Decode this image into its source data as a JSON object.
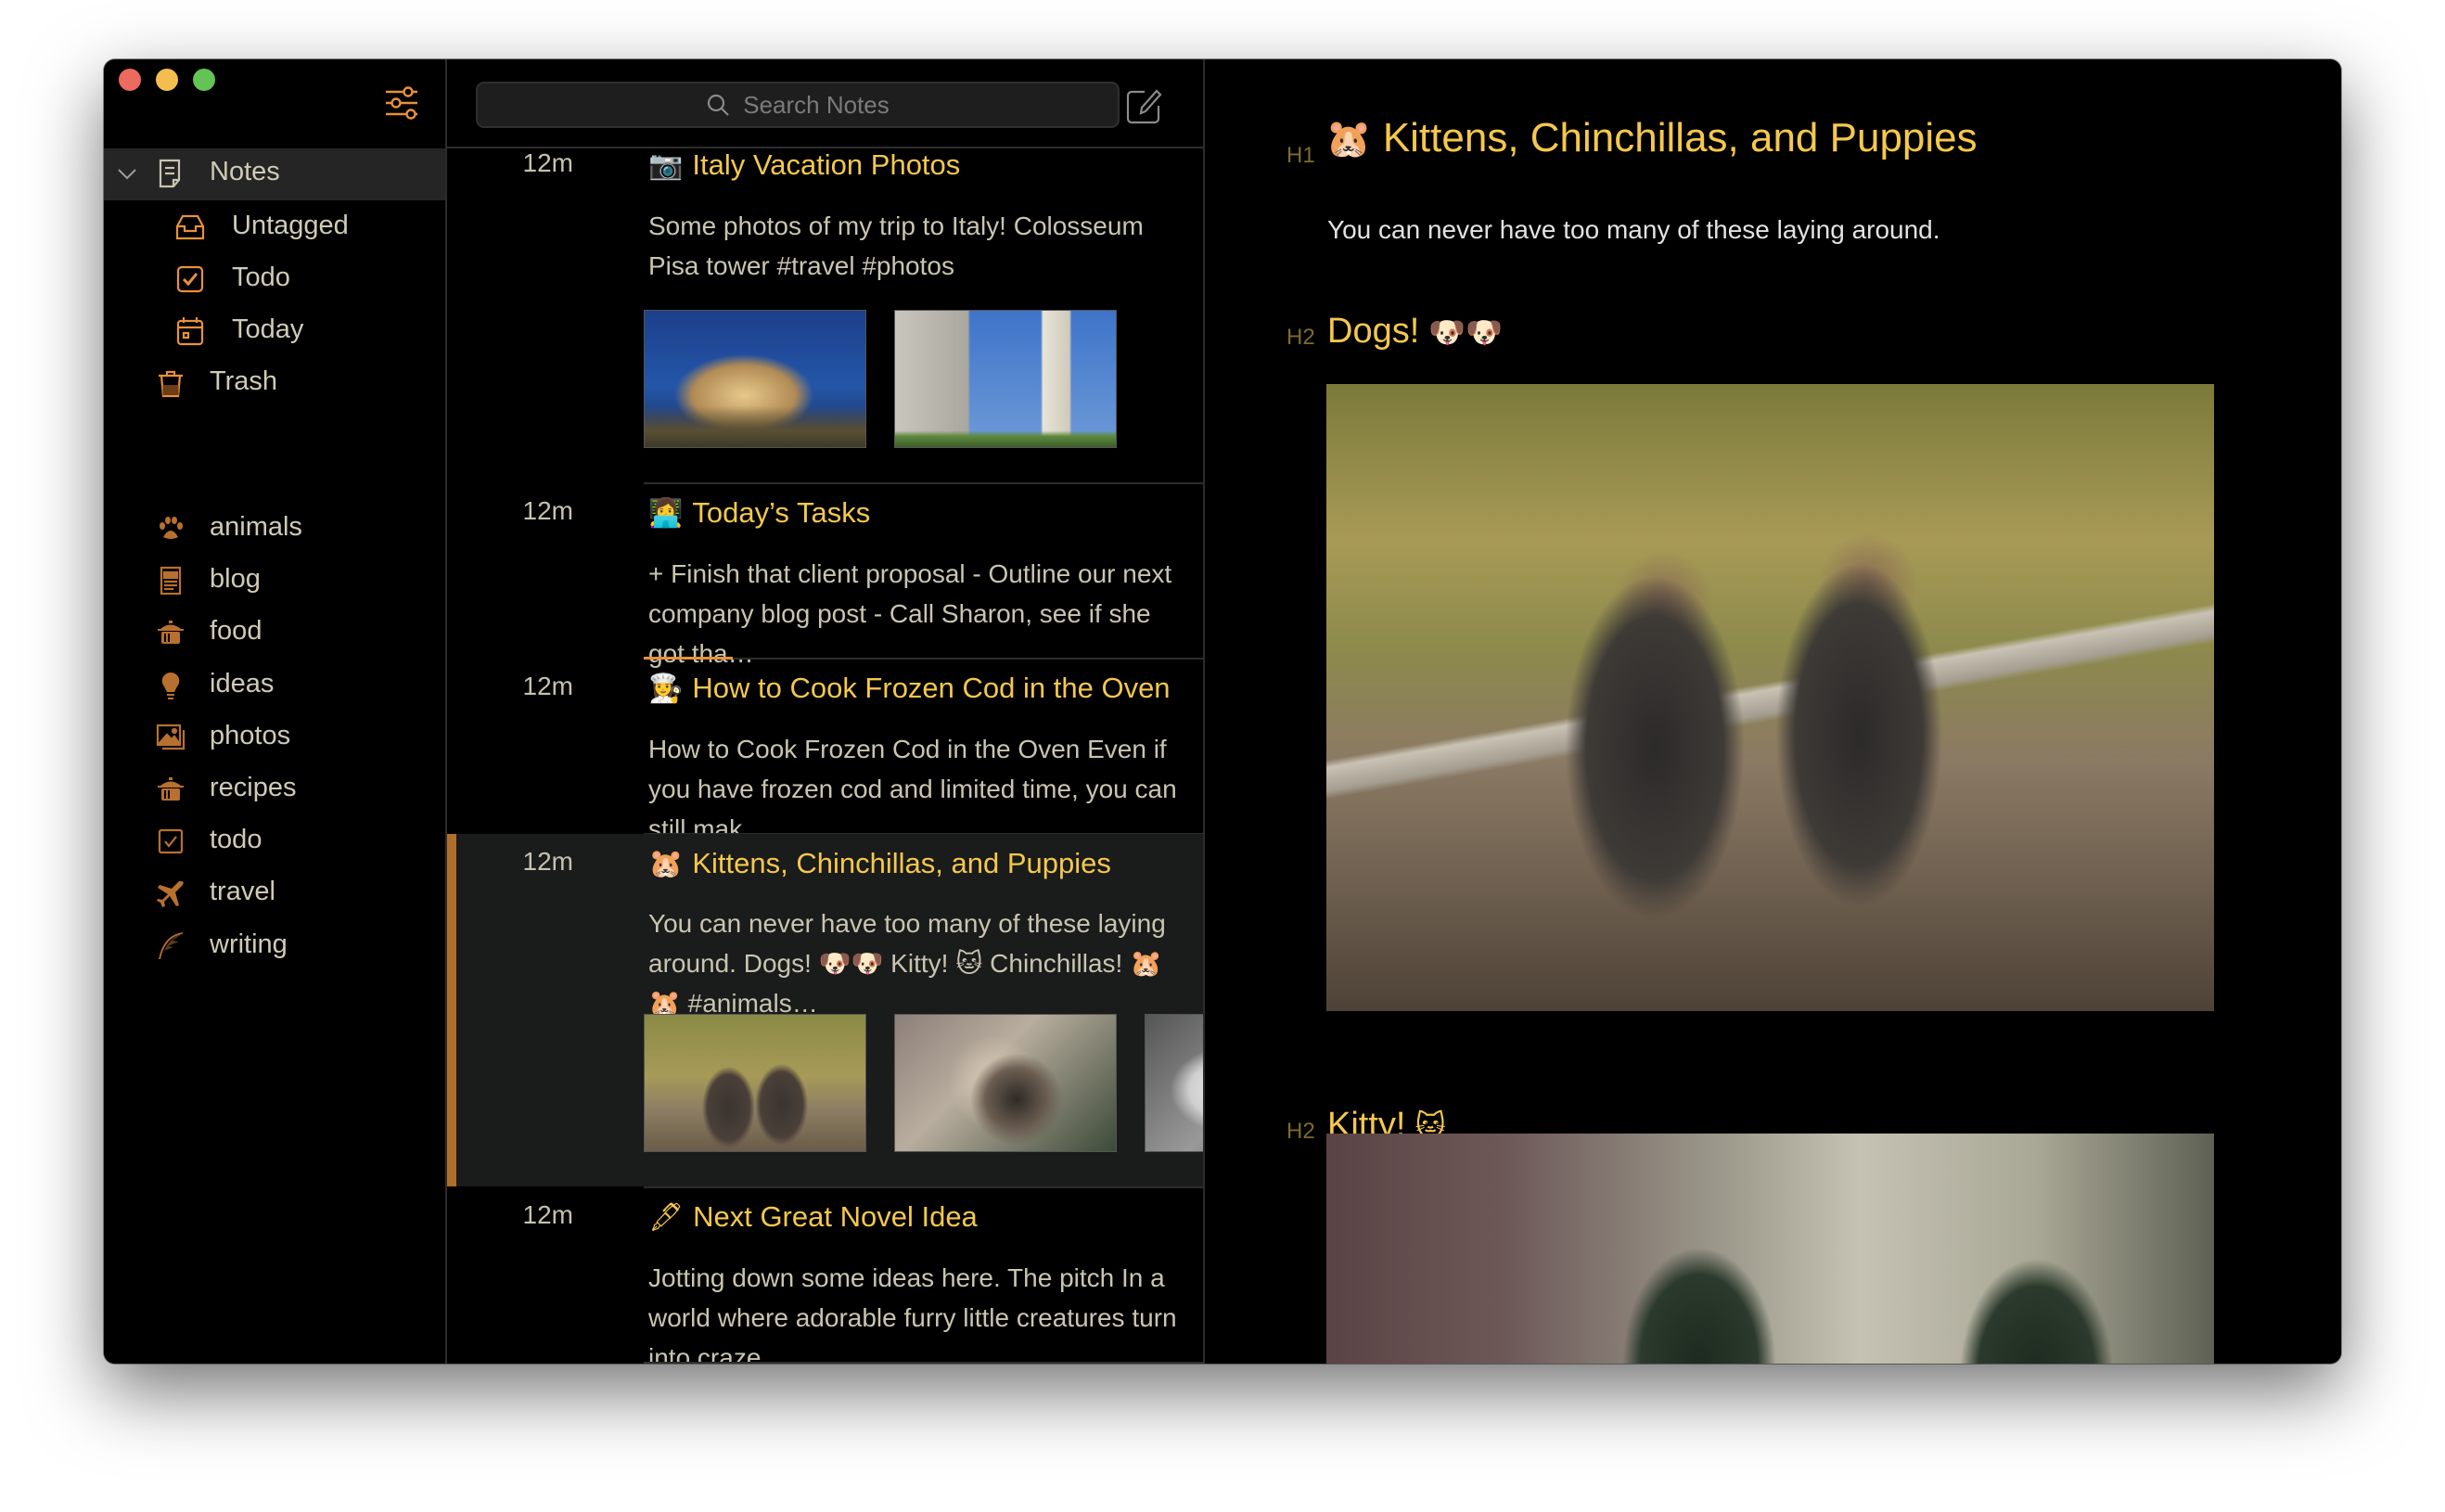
{
  "window": {
    "traffic_lights": [
      {
        "name": "close",
        "color": "#ec6a5e"
      },
      {
        "name": "minimize",
        "color": "#f4be4f"
      },
      {
        "name": "zoom",
        "color": "#61c454"
      }
    ]
  },
  "colors": {
    "accent": "#e8913a",
    "title": "#f5c84c",
    "selected_bar": "#b06f2c"
  },
  "sidebar": {
    "filter_icon": "sliders-icon",
    "notes": {
      "label": "Notes",
      "icon": "note-icon",
      "expanded": true
    },
    "sections": [
      {
        "label": "Untagged",
        "icon": "inbox-icon"
      },
      {
        "label": "Todo",
        "icon": "checkbox-icon"
      },
      {
        "label": "Today",
        "icon": "calendar-icon"
      }
    ],
    "trash": {
      "label": "Trash",
      "icon": "trash-icon"
    },
    "tags": [
      {
        "label": "animals",
        "icon": "paw-icon"
      },
      {
        "label": "blog",
        "icon": "newspaper-icon"
      },
      {
        "label": "food",
        "icon": "pot-icon"
      },
      {
        "label": "ideas",
        "icon": "lightbulb-icon"
      },
      {
        "label": "photos",
        "icon": "photos-icon"
      },
      {
        "label": "recipes",
        "icon": "pot-icon"
      },
      {
        "label": "todo",
        "icon": "checkbox-icon"
      },
      {
        "label": "travel",
        "icon": "airplane-icon"
      },
      {
        "label": "writing",
        "icon": "quill-icon"
      }
    ]
  },
  "note_list": {
    "search_placeholder": "Search Notes",
    "compose_icon": "compose-icon",
    "notes": [
      {
        "time": "12m",
        "emoji": "📷",
        "title": "Italy Vacation Photos",
        "snippet": "Some photos of my trip to Italy! Colosseum Pisa tower #travel #photos",
        "thumbnails": [
          "Colosseum photo",
          "Pisa tower photo"
        ],
        "selected": false
      },
      {
        "time": "12m",
        "emoji": "👩‍💻",
        "title": "Today’s Tasks",
        "snippet": "+ Finish that client proposal - Outline our next company blog post - Call Sharon, see if she got tha…",
        "progress": 0.16,
        "selected": false
      },
      {
        "time": "12m",
        "emoji": "👩‍🍳",
        "title": "How to Cook Frozen Cod in the Oven",
        "snippet": "How to Cook Frozen Cod in the Oven Even if you have frozen cod and limited time, you can still mak…",
        "selected": false
      },
      {
        "time": "12m",
        "emoji": "🐹",
        "title": "Kittens, Chinchillas, and Puppies",
        "snippet": "You can never have too many of these laying around. Dogs! 🐶🐶 Kitty! 🐱 Chinchillas! 🐹🐹 #animals…",
        "thumbnails": [
          "Two dogs photo",
          "Siamese kitten photo",
          "Chinchilla photo"
        ],
        "selected": true
      },
      {
        "time": "12m",
        "emoji": "🖋",
        "title": "Next Great Novel Idea",
        "snippet": "Jotting down some ideas here. The pitch In a world where adorable furry little creatures turn into craze…",
        "selected": false
      }
    ]
  },
  "editor": {
    "h1_marker": "H1",
    "title_emoji": "🐹",
    "title": "Kittens, Chinchillas, and Puppies",
    "body": "You can never have too many of these laying around.",
    "sections": [
      {
        "marker": "H2",
        "heading": "Dogs!",
        "emoji": "🐶🐶",
        "image": "Two dogs sitting photo"
      },
      {
        "marker": "H2",
        "heading": "Kitty!",
        "emoji": "🐱",
        "image": "Kitten photo"
      }
    ],
    "toolbar_icons": [
      "info-icon",
      "share-icon",
      "trash-icon"
    ],
    "bottom_icons": [
      "pen-nib-icon",
      "sidebar-layout-icon"
    ]
  }
}
